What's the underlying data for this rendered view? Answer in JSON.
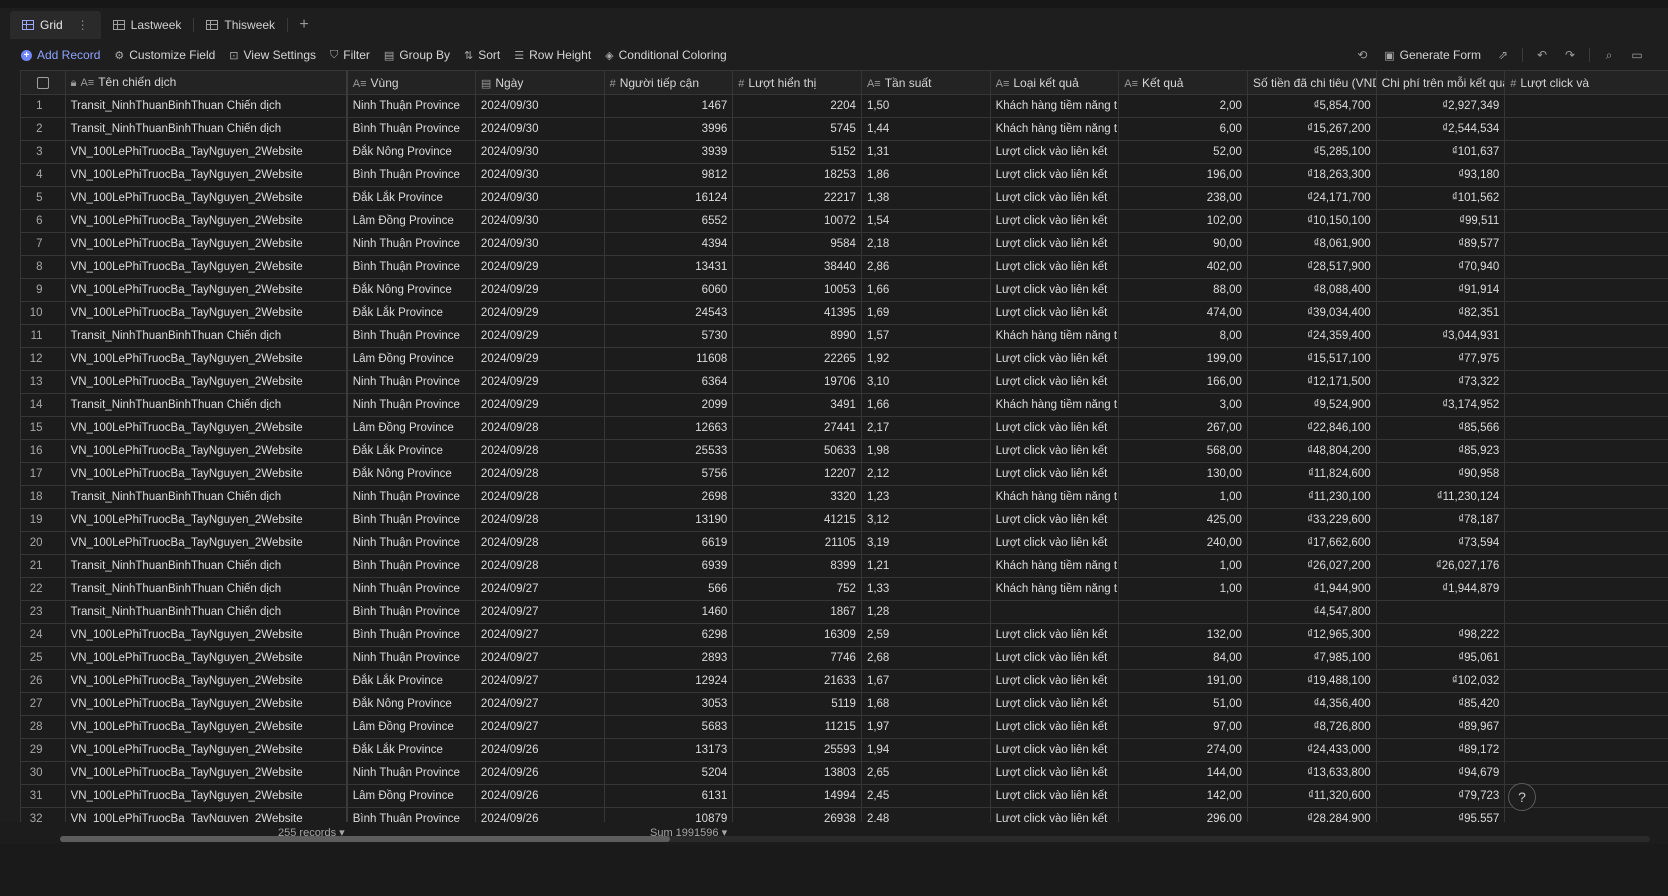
{
  "views": [
    {
      "label": "Grid",
      "icon": "grid-icon",
      "active": true
    },
    {
      "label": "Lastweek",
      "icon": "grid-icon",
      "active": false
    },
    {
      "label": "Thisweek",
      "icon": "grid-icon",
      "active": false
    }
  ],
  "add_view_symbol": "+",
  "toolbar": {
    "add_record": "Add Record",
    "customize_field": "Customize Field",
    "view_settings": "View Settings",
    "filter": "Filter",
    "group_by": "Group By",
    "sort": "Sort",
    "row_height": "Row Height",
    "conditional_coloring": "Conditional Coloring",
    "generate_form": "Generate Form"
  },
  "columns": [
    {
      "name": "Tên chiến dịch",
      "type_icon": "A≡"
    },
    {
      "name": "Vùng",
      "type_icon": "A≡"
    },
    {
      "name": "Ngày",
      "type_icon": "▤"
    },
    {
      "name": "Người tiếp cận",
      "type_icon": "#"
    },
    {
      "name": "Lượt hiển thị",
      "type_icon": "#"
    },
    {
      "name": "Tần suất",
      "type_icon": "A≡"
    },
    {
      "name": "Loại kết quả",
      "type_icon": "A≡"
    },
    {
      "name": "Kết quả",
      "type_icon": "A≡"
    },
    {
      "name": "Số tiền đã chi tiêu (VND)",
      "type_icon": ""
    },
    {
      "name": "Chi phí trên mỗi kết quả",
      "type_icon": ""
    },
    {
      "name": "Lượt click và",
      "type_icon": "#"
    }
  ],
  "rows": [
    [
      "1",
      "Transit_NinhThuanBinhThuan Chiến dịch",
      "Ninh Thuận Province",
      "2024/09/30",
      "1467",
      "2204",
      "1,50",
      "Khách hàng tiềm năng t...",
      "2,00",
      "₫5,854,700",
      "₫2,927,349"
    ],
    [
      "2",
      "Transit_NinhThuanBinhThuan Chiến dịch",
      "Bình Thuận Province",
      "2024/09/30",
      "3996",
      "5745",
      "1,44",
      "Khách hàng tiềm năng t...",
      "6,00",
      "₫15,267,200",
      "₫2,544,534"
    ],
    [
      "3",
      "VN_100LePhiTruocBa_TayNguyen_2Website",
      "Đắk Nông Province",
      "2024/09/30",
      "3939",
      "5152",
      "1,31",
      "Lượt click vào liên kết",
      "52,00",
      "₫5,285,100",
      "₫101,637"
    ],
    [
      "4",
      "VN_100LePhiTruocBa_TayNguyen_2Website",
      "Bình Thuận Province",
      "2024/09/30",
      "9812",
      "18253",
      "1,86",
      "Lượt click vào liên kết",
      "196,00",
      "₫18,263,300",
      "₫93,180"
    ],
    [
      "5",
      "VN_100LePhiTruocBa_TayNguyen_2Website",
      "Đắk Lắk Province",
      "2024/09/30",
      "16124",
      "22217",
      "1,38",
      "Lượt click vào liên kết",
      "238,00",
      "₫24,171,700",
      "₫101,562"
    ],
    [
      "6",
      "VN_100LePhiTruocBa_TayNguyen_2Website",
      "Lâm Đồng Province",
      "2024/09/30",
      "6552",
      "10072",
      "1,54",
      "Lượt click vào liên kết",
      "102,00",
      "₫10,150,100",
      "₫99,511"
    ],
    [
      "7",
      "VN_100LePhiTruocBa_TayNguyen_2Website",
      "Ninh Thuận Province",
      "2024/09/30",
      "4394",
      "9584",
      "2,18",
      "Lượt click vào liên kết",
      "90,00",
      "₫8,061,900",
      "₫89,577"
    ],
    [
      "8",
      "VN_100LePhiTruocBa_TayNguyen_2Website",
      "Bình Thuận Province",
      "2024/09/29",
      "13431",
      "38440",
      "2,86",
      "Lượt click vào liên kết",
      "402,00",
      "₫28,517,900",
      "₫70,940"
    ],
    [
      "9",
      "VN_100LePhiTruocBa_TayNguyen_2Website",
      "Đắk Nông Province",
      "2024/09/29",
      "6060",
      "10053",
      "1,66",
      "Lượt click vào liên kết",
      "88,00",
      "₫8,088,400",
      "₫91,914"
    ],
    [
      "10",
      "VN_100LePhiTruocBa_TayNguyen_2Website",
      "Đắk Lắk Province",
      "2024/09/29",
      "24543",
      "41395",
      "1,69",
      "Lượt click vào liên kết",
      "474,00",
      "₫39,034,400",
      "₫82,351"
    ],
    [
      "11",
      "Transit_NinhThuanBinhThuan Chiến dịch",
      "Bình Thuận Province",
      "2024/09/29",
      "5730",
      "8990",
      "1,57",
      "Khách hàng tiềm năng t...",
      "8,00",
      "₫24,359,400",
      "₫3,044,931"
    ],
    [
      "12",
      "VN_100LePhiTruocBa_TayNguyen_2Website",
      "Lâm Đồng Province",
      "2024/09/29",
      "11608",
      "22265",
      "1,92",
      "Lượt click vào liên kết",
      "199,00",
      "₫15,517,100",
      "₫77,975"
    ],
    [
      "13",
      "VN_100LePhiTruocBa_TayNguyen_2Website",
      "Ninh Thuận Province",
      "2024/09/29",
      "6364",
      "19706",
      "3,10",
      "Lượt click vào liên kết",
      "166,00",
      "₫12,171,500",
      "₫73,322"
    ],
    [
      "14",
      "Transit_NinhThuanBinhThuan Chiến dịch",
      "Ninh Thuận Province",
      "2024/09/29",
      "2099",
      "3491",
      "1,66",
      "Khách hàng tiềm năng t...",
      "3,00",
      "₫9,524,900",
      "₫3,174,952"
    ],
    [
      "15",
      "VN_100LePhiTruocBa_TayNguyen_2Website",
      "Lâm Đồng Province",
      "2024/09/28",
      "12663",
      "27441",
      "2,17",
      "Lượt click vào liên kết",
      "267,00",
      "₫22,846,100",
      "₫85,566"
    ],
    [
      "16",
      "VN_100LePhiTruocBa_TayNguyen_2Website",
      "Đắk Lắk Province",
      "2024/09/28",
      "25533",
      "50633",
      "1,98",
      "Lượt click vào liên kết",
      "568,00",
      "₫48,804,200",
      "₫85,923"
    ],
    [
      "17",
      "VN_100LePhiTruocBa_TayNguyen_2Website",
      "Đắk Nông Province",
      "2024/09/28",
      "5756",
      "12207",
      "2,12",
      "Lượt click vào liên kết",
      "130,00",
      "₫11,824,600",
      "₫90,958"
    ],
    [
      "18",
      "Transit_NinhThuanBinhThuan Chiến dịch",
      "Ninh Thuận Province",
      "2024/09/28",
      "2698",
      "3320",
      "1,23",
      "Khách hàng tiềm năng t...",
      "1,00",
      "₫11,230,100",
      "₫11,230,124"
    ],
    [
      "19",
      "VN_100LePhiTruocBa_TayNguyen_2Website",
      "Bình Thuận Province",
      "2024/09/28",
      "13190",
      "41215",
      "3,12",
      "Lượt click vào liên kết",
      "425,00",
      "₫33,229,600",
      "₫78,187"
    ],
    [
      "20",
      "VN_100LePhiTruocBa_TayNguyen_2Website",
      "Ninh Thuận Province",
      "2024/09/28",
      "6619",
      "21105",
      "3,19",
      "Lượt click vào liên kết",
      "240,00",
      "₫17,662,600",
      "₫73,594"
    ],
    [
      "21",
      "Transit_NinhThuanBinhThuan Chiến dịch",
      "Bình Thuận Province",
      "2024/09/28",
      "6939",
      "8399",
      "1,21",
      "Khách hàng tiềm năng t...",
      "1,00",
      "₫26,027,200",
      "₫26,027,176"
    ],
    [
      "22",
      "Transit_NinhThuanBinhThuan Chiến dịch",
      "Ninh Thuận Province",
      "2024/09/27",
      "566",
      "752",
      "1,33",
      "Khách hàng tiềm năng t...",
      "1,00",
      "₫1,944,900",
      "₫1,944,879"
    ],
    [
      "23",
      "Transit_NinhThuanBinhThuan Chiến dịch",
      "Bình Thuận Province",
      "2024/09/27",
      "1460",
      "1867",
      "1,28",
      "",
      "",
      "₫4,547,800",
      ""
    ],
    [
      "24",
      "VN_100LePhiTruocBa_TayNguyen_2Website",
      "Bình Thuận Province",
      "2024/09/27",
      "6298",
      "16309",
      "2,59",
      "Lượt click vào liên kết",
      "132,00",
      "₫12,965,300",
      "₫98,222"
    ],
    [
      "25",
      "VN_100LePhiTruocBa_TayNguyen_2Website",
      "Ninh Thuận Province",
      "2024/09/27",
      "2893",
      "7746",
      "2,68",
      "Lượt click vào liên kết",
      "84,00",
      "₫7,985,100",
      "₫95,061"
    ],
    [
      "26",
      "VN_100LePhiTruocBa_TayNguyen_2Website",
      "Đắk Lắk Province",
      "2024/09/27",
      "12924",
      "21633",
      "1,67",
      "Lượt click vào liên kết",
      "191,00",
      "₫19,488,100",
      "₫102,032"
    ],
    [
      "27",
      "VN_100LePhiTruocBa_TayNguyen_2Website",
      "Đắk Nông Province",
      "2024/09/27",
      "3053",
      "5119",
      "1,68",
      "Lượt click vào liên kết",
      "51,00",
      "₫4,356,400",
      "₫85,420"
    ],
    [
      "28",
      "VN_100LePhiTruocBa_TayNguyen_2Website",
      "Lâm Đồng Province",
      "2024/09/27",
      "5683",
      "11215",
      "1,97",
      "Lượt click vào liên kết",
      "97,00",
      "₫8,726,800",
      "₫89,967"
    ],
    [
      "29",
      "VN_100LePhiTruocBa_TayNguyen_2Website",
      "Đắk Lắk Province",
      "2024/09/26",
      "13173",
      "25593",
      "1,94",
      "Lượt click vào liên kết",
      "274,00",
      "₫24,433,000",
      "₫89,172"
    ],
    [
      "30",
      "VN_100LePhiTruocBa_TayNguyen_2Website",
      "Ninh Thuận Province",
      "2024/09/26",
      "5204",
      "13803",
      "2,65",
      "Lượt click vào liên kết",
      "144,00",
      "₫13,633,800",
      "₫94,679"
    ],
    [
      "31",
      "VN_100LePhiTruocBa_TayNguyen_2Website",
      "Lâm Đồng Province",
      "2024/09/26",
      "6131",
      "14994",
      "2,45",
      "Lượt click vào liên kết",
      "142,00",
      "₫11,320,600",
      "₫79,723"
    ],
    [
      "32",
      "VN_100LePhiTruocBa_TayNguyen_2Website",
      "Bình Thuận Province",
      "2024/09/26",
      "10879",
      "26938",
      "2,48",
      "Lượt click vào liên kết",
      "296,00",
      "₫28,284,900",
      "₫95,557"
    ]
  ],
  "footer": {
    "records": "255 records",
    "sum": "Sum 1991596"
  },
  "help_symbol": "?"
}
